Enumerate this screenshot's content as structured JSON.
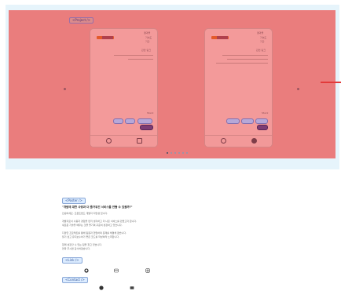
{
  "project": {
    "chip_label": "<Project />",
    "cards": [
      {
        "top_labels": [
          "결과물",
          "기여도",
          "기간"
        ],
        "section": "관련 링크",
        "desc_lines": [
          "프로젝트 설명 요약 텍스트",
          "주요 기능 및 역할"
        ],
        "footer_title": "Stack"
      },
      {
        "top_labels": [
          "결과물",
          "기여도",
          "기간"
        ],
        "section": "관련 링크",
        "desc_lines": [
          "프로젝트 설명 요약 텍스트",
          "주요 기능 및 역할 소개",
          "팀 협업과 배포 경험"
        ],
        "footer_title": "Stack"
      }
    ],
    "pager_count": 6,
    "pager_active": 0
  },
  "poster": {
    "chip_label": "<Poster />",
    "headline": "\"개발에 대한 사랑과 더 즐거워진 서비스를 만들 수 있을까?\"",
    "lines": [
      "안녕하세요. 프론트엔드 개발자 지망생 입니다.",
      "",
      "개발자로서 사용자 경험을 먼저 생각하고 더 나은 서비스를 만들고자 합니다.",
      "새로운 기술을 배우는 것을 즐기며 꾸준히 성장하고 있습니다.",
      "",
      "다양한 프로젝트를 통해 팀원과 협업하며 문제를 해결해 왔습니다.",
      "읽기 쉽고 유지보수하기 좋은 코드를 작성하려 노력합니다.",
      "",
      "함께 성장할 수 있는 팀을 찾고 있습니다.",
      "연락 주시면 감사하겠습니다."
    ]
  },
  "link": {
    "chip_label": "<Link />",
    "icons": [
      "github-icon",
      "blog-icon",
      "instagram-icon"
    ]
  },
  "contact": {
    "chip_label": "<Contact />",
    "icons": [
      "phone-icon",
      "mail-icon"
    ]
  }
}
